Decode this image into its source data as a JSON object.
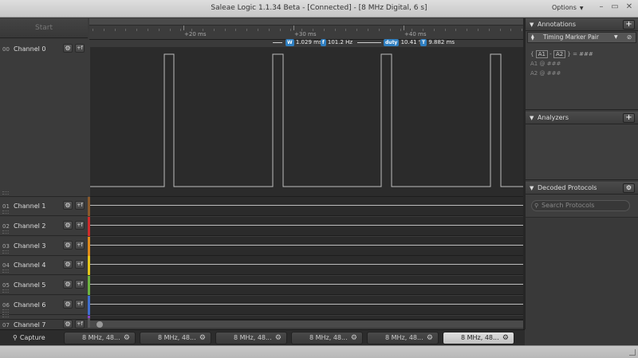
{
  "window": {
    "title": "Saleae Logic 1.1.34 Beta - [Connected] - [8 MHz Digital, 6 s]",
    "options_label": "Options",
    "minimize_glyph": "–",
    "restore_glyph": "▭",
    "close_glyph": "✕"
  },
  "toolbar": {
    "start_label": "Start"
  },
  "ruler": {
    "tick_labels": [
      "+20 ms",
      "+30 ms",
      "+40 ms"
    ]
  },
  "measurement": {
    "width_badge": "W",
    "width_value": "1.029 ms",
    "freq_badge": "f",
    "freq_value": "101.2 Hz",
    "duty_badge": "duty",
    "duty_value": "10.41 %",
    "period_badge": "T",
    "period_value": "9.882 ms"
  },
  "channels": [
    {
      "num": "00",
      "name": "Channel 0",
      "color": "#3b3b3b"
    },
    {
      "num": "01",
      "name": "Channel 1",
      "color": "#8a5a2b"
    },
    {
      "num": "02",
      "name": "Channel 2",
      "color": "#d02b2b"
    },
    {
      "num": "03",
      "name": "Channel 3",
      "color": "#e08a1a"
    },
    {
      "num": "04",
      "name": "Channel 4",
      "color": "#e6c619"
    },
    {
      "num": "05",
      "name": "Channel 5",
      "color": "#6db33f"
    },
    {
      "num": "06",
      "name": "Channel 6",
      "color": "#3f6fd0"
    },
    {
      "num": "07",
      "name": "Channel 7",
      "color": "#8a45c8"
    }
  ],
  "channel_buttons": {
    "settings_glyph": "⚙",
    "trigger_glyph": "+f"
  },
  "tabs": {
    "capture_label": "Capture",
    "capture_icon": "magnifier-icon",
    "sessions": [
      {
        "label": "8 MHz, 48...",
        "active": false
      },
      {
        "label": "8 MHz, 48...",
        "active": false
      },
      {
        "label": "8 MHz, 48...",
        "active": false
      },
      {
        "label": "8 MHz, 48...",
        "active": false
      },
      {
        "label": "8 MHz, 48...",
        "active": false
      },
      {
        "label": "8 MHz, 48...",
        "active": true
      }
    ],
    "gear_glyph": "⚙"
  },
  "annotations": {
    "title": "Annotations",
    "add_glyph": "+",
    "marker_pair_label": "Timing Marker Pair",
    "expression": {
      "a1": "A1",
      "minus": "-",
      "a2": "A2",
      "eq": "= ###"
    },
    "rows": [
      {
        "label": "A1",
        "at": "@",
        "value": "###"
      },
      {
        "label": "A2",
        "at": "@",
        "value": "###"
      }
    ]
  },
  "analyzers": {
    "title": "Analyzers",
    "add_glyph": "+"
  },
  "decoded": {
    "title": "Decoded Protocols",
    "search_placeholder": "Search Protocols",
    "gear_glyph": "⚙"
  },
  "colors": {
    "accent": "#2f7fc1",
    "trace": "#bdbdbd",
    "trace_bg": "#2b2b2b"
  }
}
